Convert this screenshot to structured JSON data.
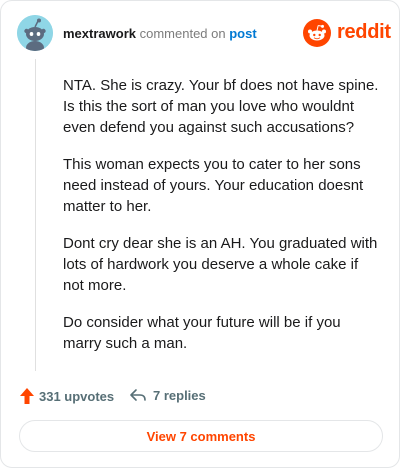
{
  "comment": {
    "username": "mextrawork",
    "action_text": "commented on",
    "target_link": "post",
    "paragraphs": [
      "NTA. She is crazy. Your bf does not have spine. Is this the sort of man you love who wouldnt even defend you against such accusations?",
      "This woman expects you to cater to her sons need instead of yours. Your education doesnt matter to her.",
      "Dont cry dear she is an AH. You graduated with lots of hardwork you deserve a whole cake if not more.",
      "Do consider what your future will be if you marry such a man."
    ]
  },
  "brand": {
    "name": "reddit",
    "accent_color": "#ff4500"
  },
  "actions": {
    "upvotes_label": "331 upvotes",
    "replies_label": "7 replies"
  },
  "footer": {
    "view_comments_label": "View 7 comments"
  },
  "icons": {
    "avatar": "snoo-avatar-icon",
    "logo": "reddit-logo-icon",
    "upvote": "upvote-arrow-icon",
    "reply": "reply-arrow-icon"
  }
}
